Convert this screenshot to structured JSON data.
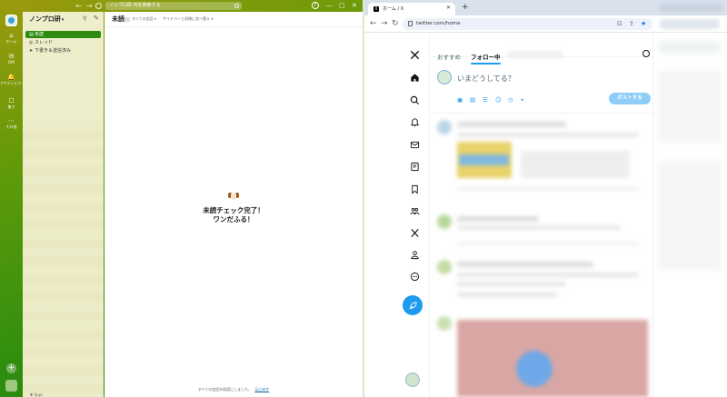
{
  "slack": {
    "search_placeholder": "ノンプロ研 内を検索する",
    "workspace_name": "ノンプロ研",
    "rail": [
      {
        "icon": "⌂",
        "label": "ホーム"
      },
      {
        "icon": "✉",
        "label": "DM"
      },
      {
        "icon": "🔔",
        "label": "アクティビティ"
      },
      {
        "icon": "☐",
        "label": "後で"
      },
      {
        "icon": "⋯",
        "label": "その他"
      }
    ],
    "sidebar_items": [
      {
        "icon": "▤",
        "label": "未読"
      },
      {
        "icon": "◎",
        "label": "スレッド"
      },
      {
        "icon": "➤",
        "label": "下書き＆送信済み"
      }
    ],
    "sidebar_footer": "▼ Apps",
    "main_title": "未読",
    "filter_all": "すべての会話",
    "filter_sidebar": "サイドバーと同様に並べ替え",
    "empty_line1": "未読チェック完了！",
    "empty_line2": "ワンだふる！",
    "footer_text": "すべての会話を既読にしました。",
    "footer_link": "元に戻す",
    "window_controls": {
      "minimize": "—",
      "maximize": "▢",
      "close": "✕"
    }
  },
  "browser": {
    "tab_favicon": "X",
    "tab_title": "ホーム / X",
    "url": "twitter.com/home"
  },
  "x": {
    "tab_foryou": "おすすめ",
    "tab_following": "フォロー中",
    "composer_placeholder": "いまどうしてる？",
    "post_button": "ポストする",
    "accent": "#1d9bf0"
  }
}
